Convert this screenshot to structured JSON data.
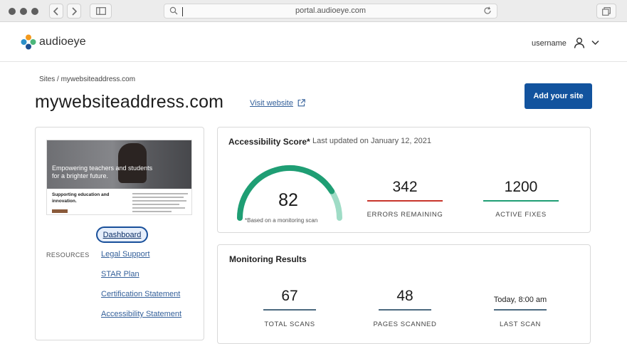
{
  "browser": {
    "url": "portal.audioeye.com"
  },
  "header": {
    "logo_text": "audioeye",
    "username": "username"
  },
  "breadcrumb": "Sites / mywebsiteaddress.com",
  "page_title": "mywebsiteaddress.com",
  "visit_link": "Visit website",
  "add_site_button": "Add your site",
  "site_preview": {
    "hero_text": "Empowering teachers and students for a brighter future.",
    "sub_text": "Supporting education and innovation."
  },
  "nav": {
    "dashboard": "Dashboard",
    "resources_label": "RESOURCES",
    "links": [
      "Legal Support",
      "STAR Plan",
      "Certification Statement",
      "Accessibility Statement"
    ]
  },
  "accessibility": {
    "title": "Accessibility Score*",
    "updated": "Last updated on January 12, 2021",
    "score": "82",
    "score_fraction": 0.82,
    "note": "*Based on a monitoring scan",
    "errors_value": "342",
    "errors_label": "ERRORS REMAINING",
    "fixes_value": "1200",
    "fixes_label": "ACTIVE FIXES"
  },
  "monitoring": {
    "title": "Monitoring Results",
    "total_scans_value": "67",
    "total_scans_label": "TOTAL SCANS",
    "pages_value": "48",
    "pages_label": "PAGES SCANNED",
    "last_scan_value": "Today, 8:00 am",
    "last_scan_label": "LAST SCAN"
  },
  "colors": {
    "gauge_fill": "#1f9e74",
    "gauge_track": "#9fdcc6",
    "errors_accent": "#c8352b",
    "fixes_accent": "#1f9e74",
    "neutral_accent": "#4d6a80",
    "primary_button": "#12539e"
  }
}
